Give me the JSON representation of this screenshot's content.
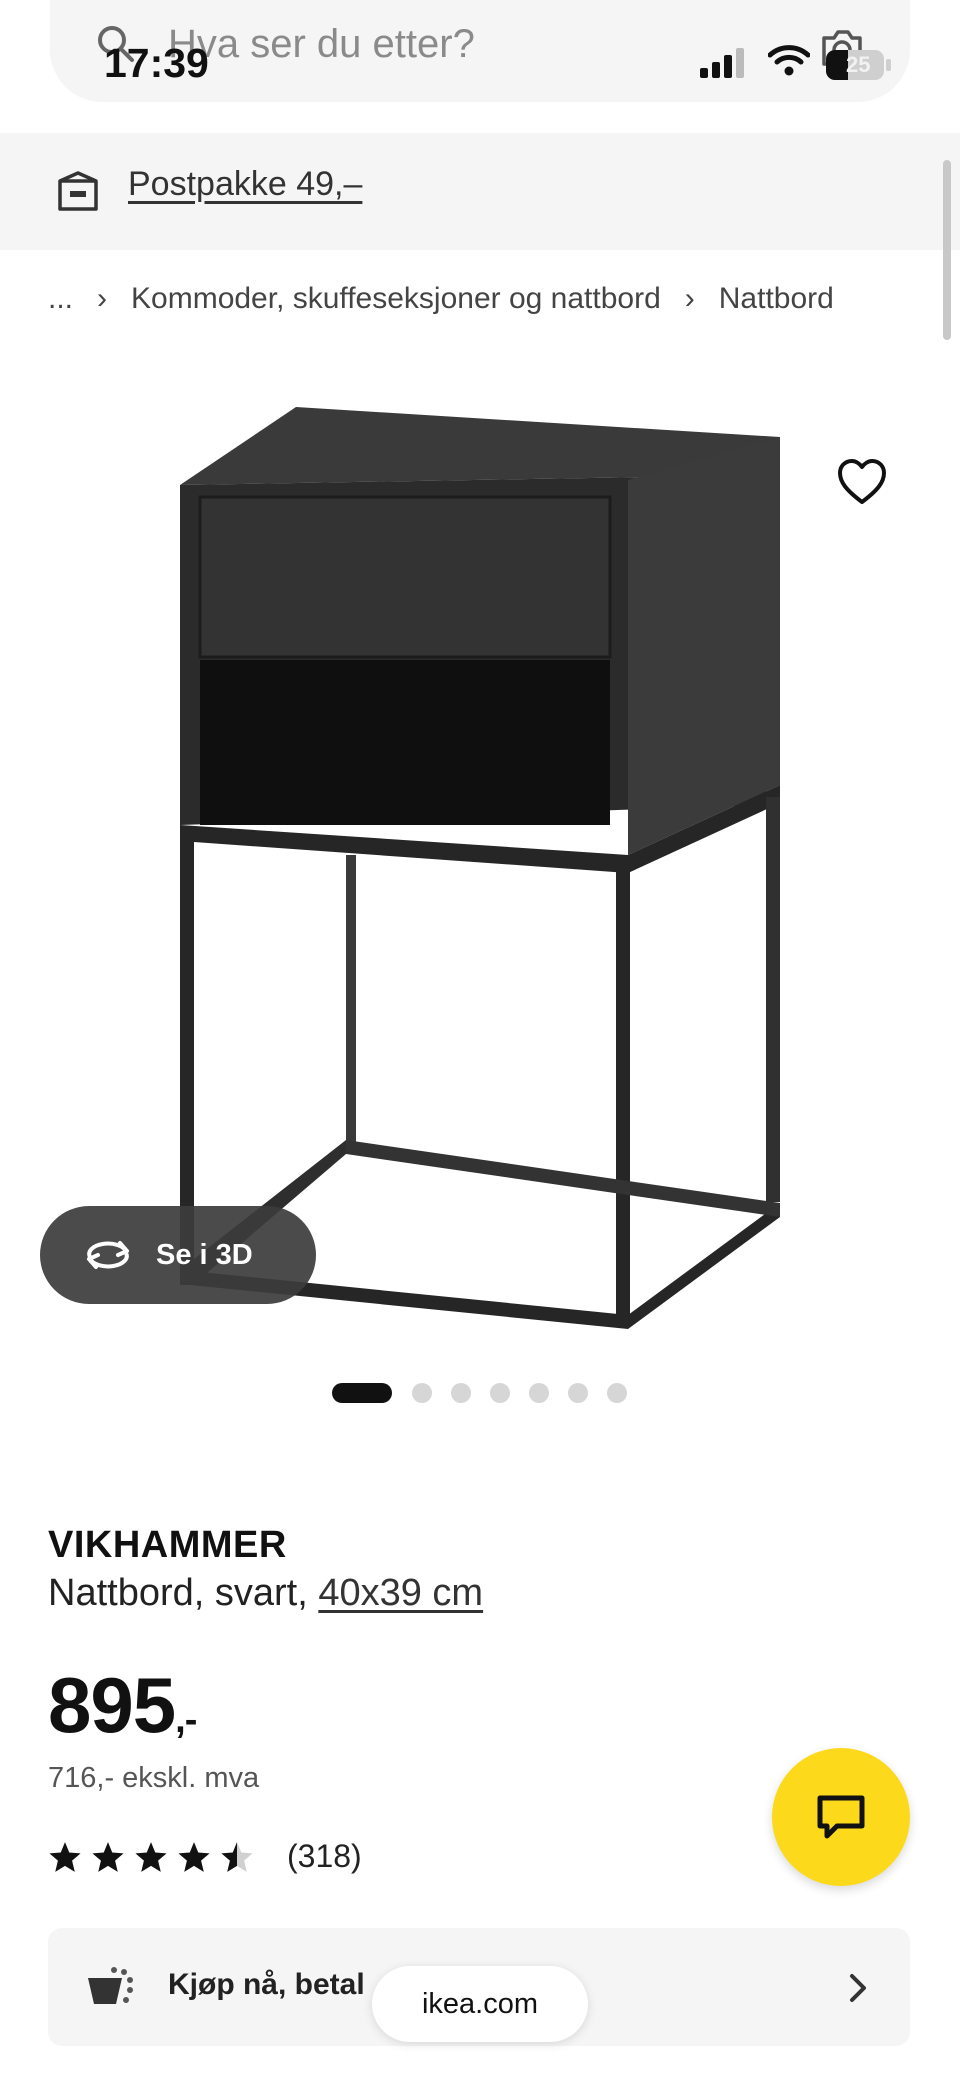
{
  "status_bar": {
    "time": "17:39",
    "battery": "25"
  },
  "search": {
    "placeholder": "Hva ser du etter?"
  },
  "shipping": {
    "label": "Postpakke 49,–"
  },
  "breadcrumb": {
    "ellipsis": "...",
    "items": [
      "Kommoder, skuffeseksjoner og nattbord",
      "Nattbord"
    ]
  },
  "gallery": {
    "view3d_label": "Se i 3D",
    "image_count": 7,
    "active_index": 0
  },
  "product": {
    "name": "VIKHAMMER",
    "description": "Nattbord, svart,",
    "dimensions": "40x39 cm",
    "price": "895",
    "price_suffix": ",-",
    "price_ex_vat": "716,- ekskl. mva",
    "rating": 4.5,
    "review_count": "(318)"
  },
  "payment": {
    "label": "Kjøp nå, betal"
  },
  "browser": {
    "url": "ikea.com"
  },
  "colors": {
    "accent_yellow": "#fcd91a",
    "product_black": "#2e2e2e",
    "banner_gray": "#f5f5f5"
  },
  "icons": [
    "search-icon",
    "camera-icon",
    "cellular-icon",
    "wifi-icon",
    "battery-icon",
    "parcel-icon",
    "heart-icon",
    "rotate-3d-icon",
    "chat-icon",
    "star-icon",
    "payment-icon",
    "chevron-right-icon"
  ]
}
